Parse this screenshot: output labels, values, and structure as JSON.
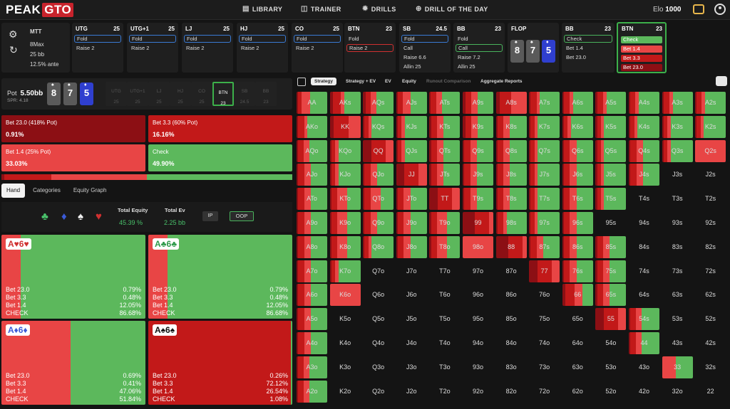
{
  "app": {
    "brand_left": "PEAK",
    "brand_right": "GTO"
  },
  "nav": {
    "library": "LIBRARY",
    "trainer": "TRAINER",
    "drills": "DRILLS",
    "drill_of_day": "DRILL OF THE DAY"
  },
  "elo": {
    "label": "Elo",
    "value": "1000"
  },
  "settings": {
    "format": "MTT",
    "table": "8Max",
    "stack": "25 bb",
    "ante": "12.5% ante"
  },
  "positions": [
    {
      "name": "UTG",
      "stack": "25",
      "actions": [
        "Fold",
        "Raise 2"
      ],
      "selected": 0
    },
    {
      "name": "UTG+1",
      "stack": "25",
      "actions": [
        "Fold",
        "Raise 2"
      ],
      "selected": 0
    },
    {
      "name": "LJ",
      "stack": "25",
      "actions": [
        "Fold",
        "Raise 2"
      ],
      "selected": 0
    },
    {
      "name": "HJ",
      "stack": "25",
      "actions": [
        "Fold",
        "Raise 2"
      ],
      "selected": 0
    },
    {
      "name": "CO",
      "stack": "25",
      "actions": [
        "Fold",
        "Raise 2"
      ],
      "selected": 0
    },
    {
      "name": "BTN",
      "stack": "23",
      "actions": [
        "Fold",
        "Raise 2"
      ],
      "selected": 1
    },
    {
      "name": "SB",
      "stack": "24.5",
      "actions": [
        "Fold",
        "Call",
        "Raise 6.6",
        "Allin 25"
      ],
      "selected": 0
    },
    {
      "name": "BB",
      "stack": "23",
      "actions": [
        "Fold",
        "Call",
        "Raise 7.2",
        "Allin 25"
      ],
      "selected": 1
    }
  ],
  "flop": {
    "label": "FLOP",
    "cards": [
      "8",
      "7",
      "5"
    ]
  },
  "bb_node": {
    "name": "BB",
    "stack": "23",
    "actions": [
      "Check",
      "Bet 1.4",
      "Bet 23.0"
    ]
  },
  "btn_node": {
    "name": "BTN",
    "stack": "23",
    "actions": [
      "Check",
      "Bet 1.4",
      "Bet 3.3",
      "Bet 23.0"
    ]
  },
  "pot": {
    "label": "Pot",
    "value": "5.50bb",
    "spr": "SPR: 4.18"
  },
  "mini_positions": [
    {
      "name": "UTG",
      "stack": "25"
    },
    {
      "name": "UTG+1",
      "stack": "25"
    },
    {
      "name": "LJ",
      "stack": "25"
    },
    {
      "name": "HJ",
      "stack": "25"
    },
    {
      "name": "CO",
      "stack": "25"
    },
    {
      "name": "BTN",
      "stack": "23"
    },
    {
      "name": "SB",
      "stack": "24.5"
    },
    {
      "name": "BB",
      "stack": "23"
    }
  ],
  "strategies": [
    {
      "label": "Bet 23.0 (418% Pot)",
      "freq": "0.91%",
      "color": "#8c0f14"
    },
    {
      "label": "Bet 3.3 (60% Pot)",
      "freq": "16.16%",
      "color": "#c21919"
    },
    {
      "label": "Bet 1.4 (25% Pot)",
      "freq": "33.03%",
      "color": "#e84545"
    },
    {
      "label": "Check",
      "freq": "49.90%",
      "color": "#5cb85c"
    }
  ],
  "hand_tabs": [
    "Hand",
    "Categories",
    "Equity Graph"
  ],
  "equity": {
    "total_equity_label": "Total Equity",
    "total_equity": "45.39 %",
    "total_ev_label": "Total Ev",
    "total_ev": "2.25 bb",
    "ip": "IP",
    "oop": "OOP"
  },
  "combos": [
    {
      "hand": "A♥6♥",
      "rows": [
        [
          "Bet 23.0",
          "0.79%"
        ],
        [
          "Bet 3.3",
          "0.48%"
        ],
        [
          "Bet 1.4",
          "12.05%"
        ],
        [
          "CHECK",
          "86.68%"
        ]
      ],
      "check": 0.8668
    },
    {
      "hand": "A♣6♣",
      "rows": [
        [
          "Bet 23.0",
          "0.79%"
        ],
        [
          "Bet 3.3",
          "0.48%"
        ],
        [
          "Bet 1.4",
          "12.05%"
        ],
        [
          "CHECK",
          "86.68%"
        ]
      ],
      "check": 0.8668
    },
    {
      "hand": "A♦6♦",
      "rows": [
        [
          "Bet 23.0",
          "0.69%"
        ],
        [
          "Bet 3.3",
          "0.41%"
        ],
        [
          "Bet 1.4",
          "47.06%"
        ],
        [
          "CHECK",
          "51.84%"
        ]
      ],
      "check": 0.5184
    },
    {
      "hand": "A♠6♠",
      "rows": [
        [
          "Bet 23.0",
          "0.26%"
        ],
        [
          "Bet 3.3",
          "72.12%"
        ],
        [
          "Bet 1.4",
          "26.54%"
        ],
        [
          "CHECK",
          "1.08%"
        ]
      ],
      "check": 0.0108
    }
  ],
  "right_tabs": [
    "Strategy",
    "Strategy + EV",
    "EV",
    "Equity",
    "Runout Comparison",
    "Aggregate Reports"
  ],
  "ranks": [
    "A",
    "K",
    "Q",
    "J",
    "T",
    "9",
    "8",
    "7",
    "6",
    "5",
    "4",
    "3",
    "2"
  ],
  "matrix_fills": [
    [
      [
        0.05,
        0.25,
        0.3
      ],
      [
        0.1,
        0.4,
        0.1
      ],
      [
        0.1,
        0.3,
        0.2
      ],
      [
        0.05,
        0.3,
        0.3
      ],
      [
        0.05,
        0.3,
        0.2
      ],
      [
        0.1,
        0.3,
        0.2
      ],
      [
        0.1,
        0.5,
        0.4
      ],
      [
        0.05,
        0.3,
        0.1
      ],
      [
        0.05,
        0.3,
        0.1
      ],
      [
        0.05,
        0.3,
        0.1
      ],
      [
        0.05,
        0.25,
        0.1
      ],
      [
        0.05,
        0.3,
        0.1
      ],
      [
        0.05,
        0.25,
        0.1
      ]
    ],
    [
      [
        0.05,
        0.3,
        0.1
      ],
      [
        0.1,
        0.6,
        0.3
      ],
      [
        0.05,
        0.2,
        0.1
      ],
      [
        0.05,
        0.2,
        0.1
      ],
      [
        0.05,
        0.3,
        0.2
      ],
      [
        0.1,
        0.3,
        0.2
      ],
      [
        0.05,
        0.3,
        0.2
      ],
      [
        0.05,
        0.2,
        0.1
      ],
      [
        0.05,
        0.2,
        0.1
      ],
      [
        0.05,
        0.2,
        0.1
      ],
      [
        0.05,
        0.2,
        0.1
      ],
      [
        0.05,
        0.2,
        0.1
      ],
      [
        0.05,
        0.2,
        0.1
      ]
    ],
    [
      [
        0.05,
        0.3,
        0.2
      ],
      [
        0.05,
        0.2,
        0.1
      ],
      [
        0.2,
        0.6,
        0.2
      ],
      [
        0.05,
        0.2,
        0.1
      ],
      [
        0.05,
        0.3,
        0.2
      ],
      [
        0.05,
        0.3,
        0.2
      ],
      [
        0.05,
        0.3,
        0.2
      ],
      [
        0.05,
        0.2,
        0.1
      ],
      [
        0.05,
        0.3,
        0.2
      ],
      [
        0.05,
        0.2,
        0.1
      ],
      [
        0.05,
        0.3,
        0.2
      ],
      [
        0.05,
        0.2,
        0.1
      ],
      [
        0,
        0,
        0.3
      ]
    ],
    [
      [
        0.05,
        0.3,
        0.2
      ],
      [
        0.05,
        0.2,
        0.1
      ],
      [
        0.05,
        0.3,
        0.2
      ],
      [
        0.2,
        0.6,
        0.2
      ],
      [
        0.05,
        0.3,
        0.2
      ],
      [
        0.05,
        0.3,
        0.2
      ],
      [
        0.05,
        0.3,
        0.2
      ],
      [
        0.05,
        0.2,
        0.1
      ],
      [
        0.05,
        0.3,
        0.2
      ],
      [
        0.05,
        0.2,
        0.1
      ],
      [
        0.05,
        0.3,
        0.2
      ],
      [
        0,
        0,
        0
      ],
      [
        0,
        0,
        0
      ]
    ],
    [
      [
        0.05,
        0.3,
        0.2
      ],
      [
        0.05,
        0.3,
        0.3
      ],
      [
        0.05,
        0.3,
        0.3
      ],
      [
        0.05,
        0.3,
        0.2
      ],
      [
        0.2,
        0.6,
        0.2
      ],
      [
        0.05,
        0.3,
        0.2
      ],
      [
        0.05,
        0.3,
        0.2
      ],
      [
        0.05,
        0.2,
        0.1
      ],
      [
        0.05,
        0.3,
        0.2
      ],
      [
        0.05,
        0.2,
        0.1
      ],
      [
        0,
        0,
        0
      ],
      [
        0,
        0,
        0
      ],
      [
        0,
        0,
        0
      ]
    ],
    [
      [
        0.05,
        0.3,
        0.2
      ],
      [
        0.05,
        0.3,
        0.3
      ],
      [
        0.05,
        0.3,
        0.2
      ],
      [
        0.05,
        0.3,
        0.2
      ],
      [
        0.05,
        0.3,
        0.3
      ],
      [
        0.3,
        0.6,
        0.1
      ],
      [
        0.05,
        0.3,
        0.1
      ],
      [
        0.05,
        0.2,
        0.1
      ],
      [
        0.05,
        0.3,
        0.2
      ],
      [
        0,
        0,
        0
      ],
      [
        0,
        0,
        0
      ],
      [
        0,
        0,
        0
      ],
      [
        0,
        0,
        0
      ]
    ],
    [
      [
        0.05,
        0.3,
        0.2
      ],
      [
        0.05,
        0.3,
        0.3
      ],
      [
        0.05,
        0.2,
        0.1
      ],
      [
        0.05,
        0.3,
        0.2
      ],
      [
        0.05,
        0.3,
        0.3
      ],
      [
        0,
        0,
        0.5
      ],
      [
        0.3,
        0.6,
        0.1
      ],
      [
        0.05,
        0.3,
        0.2
      ],
      [
        0.05,
        0.3,
        0.2
      ],
      [
        0.05,
        0.3,
        0.2
      ],
      [
        0,
        0,
        0
      ],
      [
        0,
        0,
        0
      ],
      [
        0,
        0,
        0
      ]
    ],
    [
      [
        0.05,
        0.3,
        0.2
      ],
      [
        0.05,
        0.2,
        0.1
      ],
      [
        0,
        0,
        0
      ],
      [
        0,
        0,
        0
      ],
      [
        0,
        0,
        0
      ],
      [
        0,
        0,
        0
      ],
      [
        0,
        0,
        0
      ],
      [
        0.2,
        0.6,
        0.2
      ],
      [
        0.05,
        0.3,
        0.2
      ],
      [
        0.05,
        0.3,
        0.2
      ],
      [
        0,
        0,
        0
      ],
      [
        0,
        0,
        0
      ],
      [
        0,
        0,
        0
      ]
    ],
    [
      [
        0.05,
        0.3,
        0.2
      ],
      [
        0,
        0,
        0.1
      ],
      [
        0,
        0,
        0
      ],
      [
        0,
        0,
        0
      ],
      [
        0,
        0,
        0
      ],
      [
        0,
        0,
        0
      ],
      [
        0,
        0,
        0
      ],
      [
        0,
        0,
        0
      ],
      [
        0.1,
        0.6,
        0.3
      ],
      [
        0.05,
        0.3,
        0.2
      ],
      [
        0,
        0,
        0
      ],
      [
        0,
        0,
        0
      ],
      [
        0,
        0,
        0
      ]
    ],
    [
      [
        0.05,
        0.3,
        0.2
      ],
      [
        0,
        0,
        0
      ],
      [
        0,
        0,
        0
      ],
      [
        0,
        0,
        0
      ],
      [
        0,
        0,
        0
      ],
      [
        0,
        0,
        0
      ],
      [
        0,
        0,
        0
      ],
      [
        0,
        0,
        0
      ],
      [
        0,
        0,
        0
      ],
      [
        0.2,
        0.6,
        0.2
      ],
      [
        0.05,
        0.3,
        0.2
      ],
      [
        0,
        0,
        0
      ],
      [
        0,
        0,
        0
      ]
    ],
    [
      [
        0.05,
        0.3,
        0.2
      ],
      [
        0,
        0,
        0
      ],
      [
        0,
        0,
        0
      ],
      [
        0,
        0,
        0
      ],
      [
        0,
        0,
        0
      ],
      [
        0,
        0,
        0
      ],
      [
        0,
        0,
        0
      ],
      [
        0,
        0,
        0
      ],
      [
        0,
        0,
        0
      ],
      [
        0,
        0,
        0
      ],
      [
        0.05,
        0.3,
        0.2
      ],
      [
        0,
        0,
        0
      ],
      [
        0,
        0,
        0
      ]
    ],
    [
      [
        0.05,
        0.3,
        0.2
      ],
      [
        0,
        0,
        0
      ],
      [
        0,
        0,
        0
      ],
      [
        0,
        0,
        0
      ],
      [
        0,
        0,
        0
      ],
      [
        0,
        0,
        0
      ],
      [
        0,
        0,
        0
      ],
      [
        0,
        0,
        0
      ],
      [
        0,
        0,
        0
      ],
      [
        0,
        0,
        0
      ],
      [
        0,
        0,
        0
      ],
      [
        0,
        0,
        0.4
      ],
      [
        0,
        0,
        0
      ]
    ],
    [
      [
        0.05,
        0.3,
        0.2
      ],
      [
        0,
        0,
        0
      ],
      [
        0,
        0,
        0
      ],
      [
        0,
        0,
        0
      ],
      [
        0,
        0,
        0
      ],
      [
        0,
        0,
        0
      ],
      [
        0,
        0,
        0
      ],
      [
        0,
        0,
        0
      ],
      [
        0,
        0,
        0
      ],
      [
        0,
        0,
        0
      ],
      [
        0,
        0,
        0
      ],
      [
        0,
        0,
        0
      ],
      [
        0,
        0,
        0
      ]
    ]
  ],
  "matrix_check": [
    [
      0.65,
      0.5,
      0.6,
      0.6,
      0.6,
      0.5,
      0.0,
      0.6,
      0.6,
      0.6,
      0.65,
      0.6,
      0.65
    ],
    [
      0.6,
      0.0,
      0.7,
      0.7,
      0.5,
      0.5,
      0.5,
      0.7,
      0.7,
      0.7,
      0.7,
      0.7,
      0.7
    ],
    [
      0.6,
      0.7,
      0.0,
      0.7,
      0.5,
      0.5,
      0.5,
      0.7,
      0.5,
      0.7,
      0.5,
      0.7,
      0.0
    ],
    [
      0.5,
      0.7,
      0.5,
      0.0,
      0.5,
      0.5,
      0.5,
      0.7,
      0.5,
      0.7,
      0.5,
      0.0,
      0.0
    ],
    [
      0.5,
      0.4,
      0.4,
      0.5,
      0.0,
      0.5,
      0.5,
      0.7,
      0.5,
      0.7,
      0.0,
      0.0,
      0.0
    ],
    [
      0.5,
      0.4,
      0.5,
      0.5,
      0.4,
      0.0,
      0.6,
      0.7,
      0.5,
      0.0,
      0.0,
      0.0,
      0.0
    ],
    [
      0.5,
      0.4,
      0.7,
      0.5,
      0.4,
      0.0,
      0.0,
      0.5,
      0.5,
      0.5,
      0.0,
      0.0,
      0.0
    ],
    [
      0.5,
      0.7,
      0.0,
      0.0,
      0.0,
      0.0,
      0.0,
      0.0,
      0.5,
      0.5,
      0.0,
      0.0,
      0.0
    ],
    [
      0.5,
      0.0,
      0.0,
      0.0,
      0.0,
      0.0,
      0.0,
      0.0,
      0.4,
      0.5,
      0.0,
      0.0,
      0.0
    ],
    [
      0.5,
      0.0,
      0.0,
      0.0,
      0.0,
      0.0,
      0.0,
      0.0,
      0.0,
      0.0,
      0.6,
      0.0,
      0.0
    ],
    [
      0.5,
      0.0,
      0.0,
      0.0,
      0.0,
      0.0,
      0.0,
      0.0,
      0.0,
      0.0,
      0.6,
      0.0,
      0.0
    ],
    [
      0.6,
      0.0,
      0.0,
      0.0,
      0.0,
      0.0,
      0.0,
      0.0,
      0.0,
      0.0,
      0.0,
      0.5,
      0.0
    ],
    [
      0.6,
      0.0,
      0.0,
      0.0,
      0.0,
      0.0,
      0.0,
      0.0,
      0.0,
      0.0,
      0.0,
      0.0,
      0.0
    ]
  ],
  "colors": {
    "check": "#5cb85c",
    "bet_small": "#e84545",
    "bet_mid": "#c21919",
    "bet_big": "#8c0f14"
  }
}
